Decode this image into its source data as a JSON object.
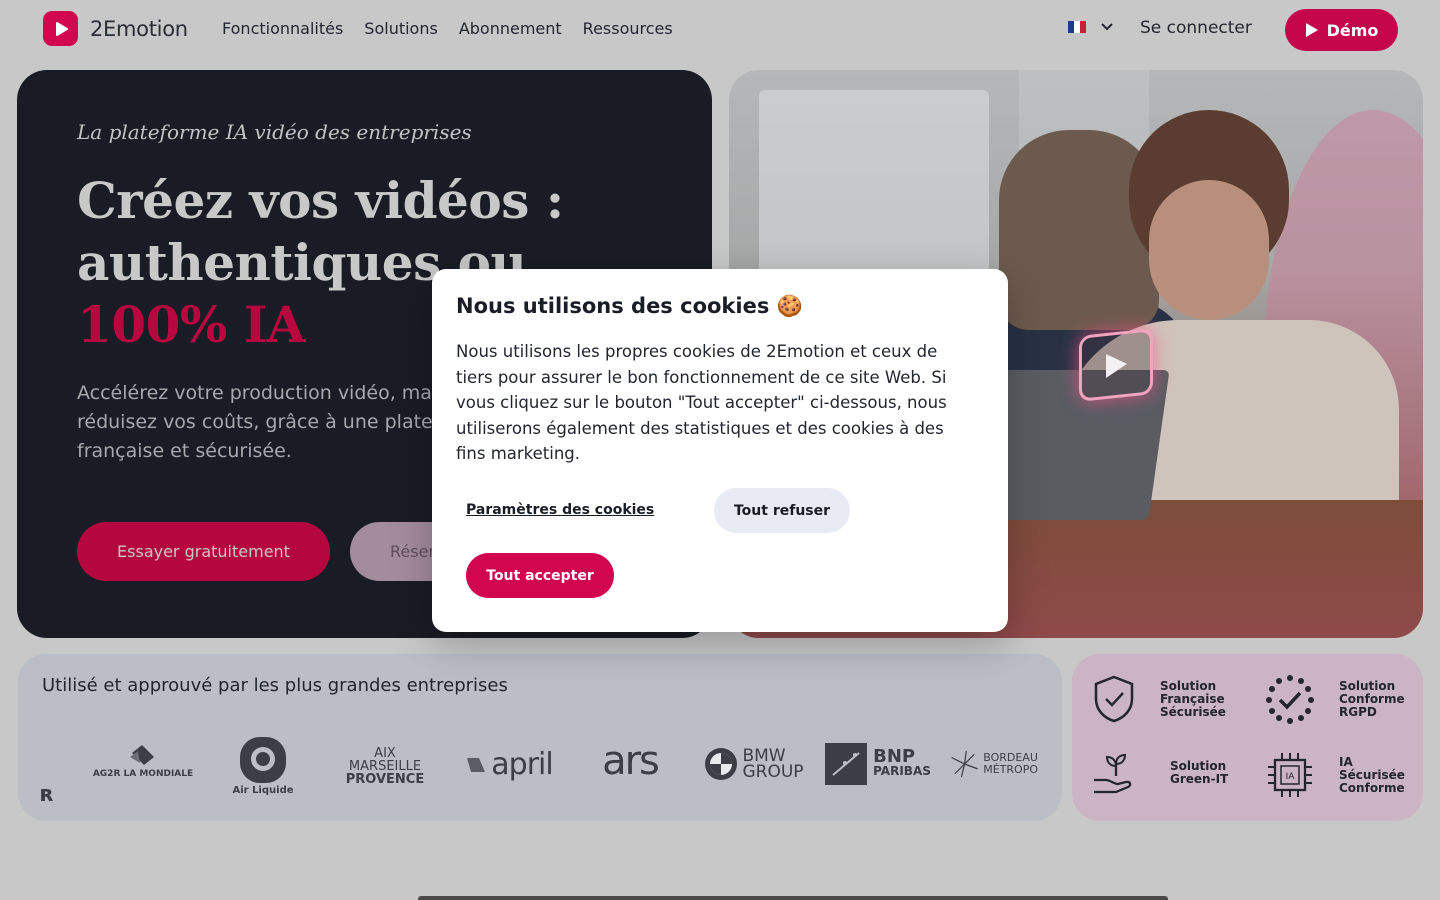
{
  "header": {
    "logo_text": "2Emotion",
    "nav": [
      "Fonctionnalités",
      "Solutions",
      "Abonnement",
      "Ressources"
    ],
    "login": "Se connecter",
    "demo": "Démo",
    "flag_colors": [
      "#1e3a8a",
      "#ffffff",
      "#c81e3a"
    ]
  },
  "hero": {
    "eyebrow": "La plateforme IA vidéo des entreprises",
    "title_line1": "Créez vos vidéos :",
    "title_line2": "authentiques ou",
    "title_accent": "100% IA",
    "lead_line1": "Accélérez votre production vidéo, ma",
    "lead_line2": "réduisez vos coûts, grâce à une plate",
    "lead_line3": "française et sécurisée.",
    "cta_try": "Essayer gratuitement",
    "cta_book": "Réser"
  },
  "clients": {
    "title": "Utilisé et approuvé par les plus grandes entreprises",
    "logos": {
      "ag2r": "AG2R LA MONDIALE",
      "airliquide": "Air Liquide",
      "aix_1": "AIX",
      "aix_2": "MARSEILLE",
      "aix_3": "PROVENCE",
      "april": "april",
      "ars": "ars",
      "bmw_1": "BMW",
      "bmw_2": "GROUP",
      "bnp_1": "BNP",
      "bnp_2": "PARIBAS",
      "bordeaux_1": "BORDEAU",
      "bordeaux_2": "MÉTROPO"
    }
  },
  "badges": [
    {
      "line1": "Solution",
      "line2": "Française",
      "line3": "Sécurisée"
    },
    {
      "line1": "Solution",
      "line2": "Conforme",
      "line3": "RGPD"
    },
    {
      "line1": "Solution",
      "line2": "Green-IT",
      "line3": ""
    },
    {
      "line1": "IA",
      "line2": "Sécurisée",
      "line3": "Conforme"
    }
  ],
  "cookie": {
    "title": "Nous utilisons des cookies 🍪",
    "body": "Nous utilisons les propres cookies de 2Emotion et ceux de tiers pour assurer le bon fonctionnement de ce site Web. Si vous cliquez sur le bouton \"Tout accepter\" ci-dessous, nous utiliserons également des statistiques et des cookies à des fins marketing.",
    "settings": "Paramètres des cookies",
    "refuse": "Tout refuser",
    "accept": "Tout accepter"
  },
  "colors": {
    "brand": "#d1064f",
    "dark_panel": "#191c24"
  }
}
